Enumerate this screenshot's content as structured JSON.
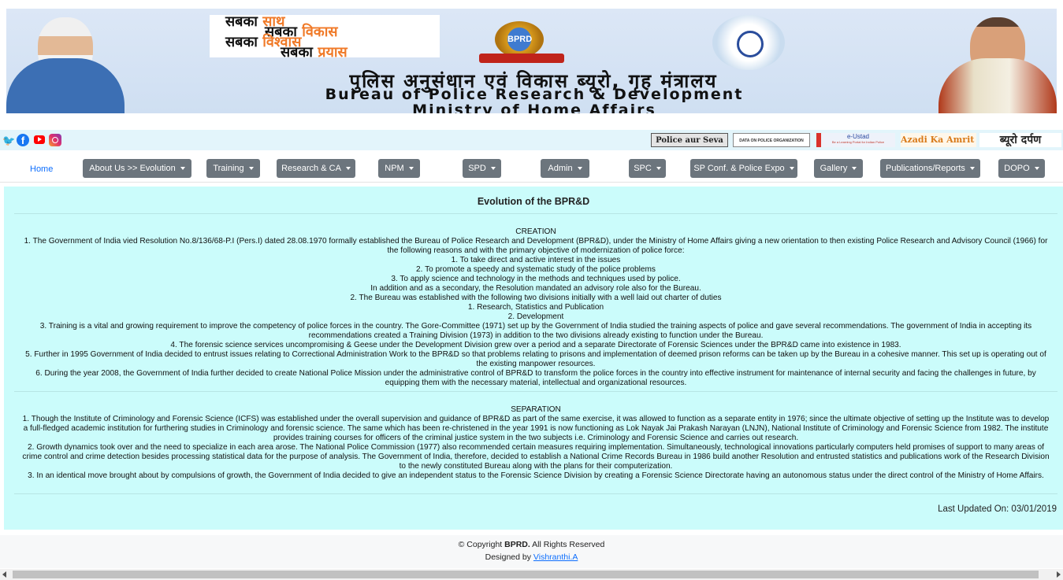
{
  "banner": {
    "slogan_lines": [
      {
        "black": "सबका ",
        "orange": "साथ"
      },
      {
        "black": "सबका ",
        "orange": "विकास"
      },
      {
        "black": "सबका ",
        "orange": "विश्वास"
      },
      {
        "black": "सबका ",
        "orange": "प्रयास"
      }
    ],
    "emblem_text": "BPRD",
    "title_hindi": "पुलिस अनुसंधान एवं विकास ब्यूरो, गृह मंत्रालय",
    "title_english_1": "Bureau of Police Research & Development",
    "title_english_2": "Ministry of Home Affairs"
  },
  "social": {
    "icons": [
      "twitter-icon",
      "facebook-icon",
      "youtube-icon",
      "instagram-icon"
    ],
    "partners": {
      "seva": "Police aur Seva",
      "data": "DATA ON POLICE ORGANIZATION",
      "eustad": "e-Ustad",
      "eustad_sub": "Be a Learning Portal for Indian Police",
      "amrit": "Azadi Ka Amrit Mahotsav",
      "darpan": "ब्यूरो दर्पण"
    }
  },
  "nav": {
    "home": "Home",
    "items": [
      "About Us >> Evolution",
      "Training",
      "Research & CA",
      "NPM",
      "SPD",
      "Admin",
      "SPC",
      "SP Conf. & Police Expo",
      "Gallery",
      "Publications/Reports",
      "DOPO"
    ]
  },
  "content": {
    "title": "Evolution of the BPR&D",
    "creation_heading": "CREATION",
    "creation_lines": [
      "1. The Government of India vied Resolution No.8/136/68-P.I (Pers.I) dated 28.08.1970 formally established the Bureau of Police Research and Development (BPR&D), under the Ministry of Home Affairs giving a new orientation to then existing Police Research and Advisory Council (1966) for the following reasons and with the primary objective of modernization of police force:",
      "1. To take direct and active interest in the issues",
      "2. To promote a speedy and systematic study of the police problems",
      "3. To apply science and technology in the methods and techniques used by police.",
      "In addition and as a secondary, the Resolution mandated an advisory role also for the Bureau.",
      "2. The Bureau was established with the following two divisions initially with a well laid out charter of duties",
      "1. Research, Statistics and Publication",
      "2. Development",
      "3. Training is a vital and growing requirement to improve the competency of police forces in the country. The Gore-Committee (1971) set up by the Government of India studied the training aspects of police and gave several recommendations. The government of India in accepting its recommendations created a Training Division (1973) in addition to the two divisions already existing to function under the Bureau.",
      "4. The forensic science services uncompromising & Geese under the Development Division grew over a period and a separate Directorate of Forensic Sciences under the BPR&D came into existence in 1983.",
      "5. Further in 1995 Government of India decided to entrust issues relating to Correctional Administration Work to the BPR&D so that problems relating to prisons and implementation of deemed prison reforms can be taken up by the Bureau in a cohesive manner. This set up is operating out of the existing manpower resources.",
      "6. During the year 2008, the Government of India further decided to create National Police Mission under the administrative control of BPR&D to transform the police forces in the country into effective instrument for maintenance of internal security and facing the challenges in future, by equipping them with the necessary material, intellectual and organizational resources."
    ],
    "separation_heading": "SEPARATION",
    "separation_lines": [
      "1. Though the Institute of Criminology and Forensic Science (ICFS) was established under the overall supervision and guidance of BPR&D as part of the same exercise, it was allowed to function as a separate entity in 1976; since the ultimate objective of setting up the Institute was to develop a full-fledged academic institution for furthering studies in Criminology and forensic science. The same which has been re-christened in the year 1991 is now functioning as Lok Nayak Jai Prakash Narayan (LNJN), National Institute of Criminology and Forensic Science from 1982. The institute provides training courses for officers of the criminal justice system in the two subjects i.e. Criminology and Forensic Science and carries out research.",
      "2. Growth dynamics took over and the need to specialize in each area arose. The National Police Commission (1977) also recommended certain measures requiring implementation. Simultaneously, technological innovations particularly computers held promises of support to many areas of crime control and crime detection besides processing statistical data for the purpose of analysis. The Government of India, therefore, decided to establish a National Crime Records Bureau in 1986 build another Resolution and entrusted statistics and publications work of the Research Division to the newly constituted Bureau along with the plans for their computerization.",
      "3. In an identical move brought about by compulsions of growth, the Government of India decided to give an independent status to the Forensic Science Division by creating a Forensic Science Directorate having an autonomous status under the direct control of the Ministry of Home Affairs."
    ],
    "last_updated": "Last Updated On: 03/01/2019"
  },
  "footer": {
    "copyright_prefix": "© Copyright ",
    "copyright_brand": "BPRD.",
    "copyright_suffix": " All Rights Reserved",
    "designed_by": "Designed by ",
    "designer": "Vishranthi.A"
  },
  "colors": {
    "content_bg": "#cbfcfb",
    "nav_button": "#6c757d",
    "link": "#0d6efd",
    "slogan_accent": "#f07a28"
  }
}
